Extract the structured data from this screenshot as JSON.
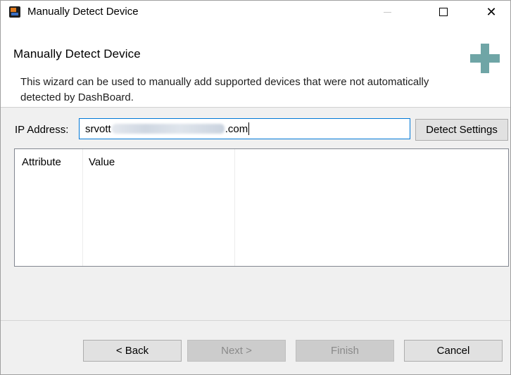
{
  "window": {
    "title": "Manually Detect Device"
  },
  "header": {
    "title": "Manually Detect Device",
    "description": "This wizard can be used to manually add supported devices that were not automatically detected by DashBoard."
  },
  "ip": {
    "label": "IP Address:",
    "value_prefix": "srvott",
    "value_suffix": ".com",
    "detect_button": "Detect Settings"
  },
  "table": {
    "columns": [
      "Attribute",
      "Value"
    ]
  },
  "footer": {
    "back": "< Back",
    "next": "Next >",
    "finish": "Finish",
    "cancel": "Cancel"
  }
}
